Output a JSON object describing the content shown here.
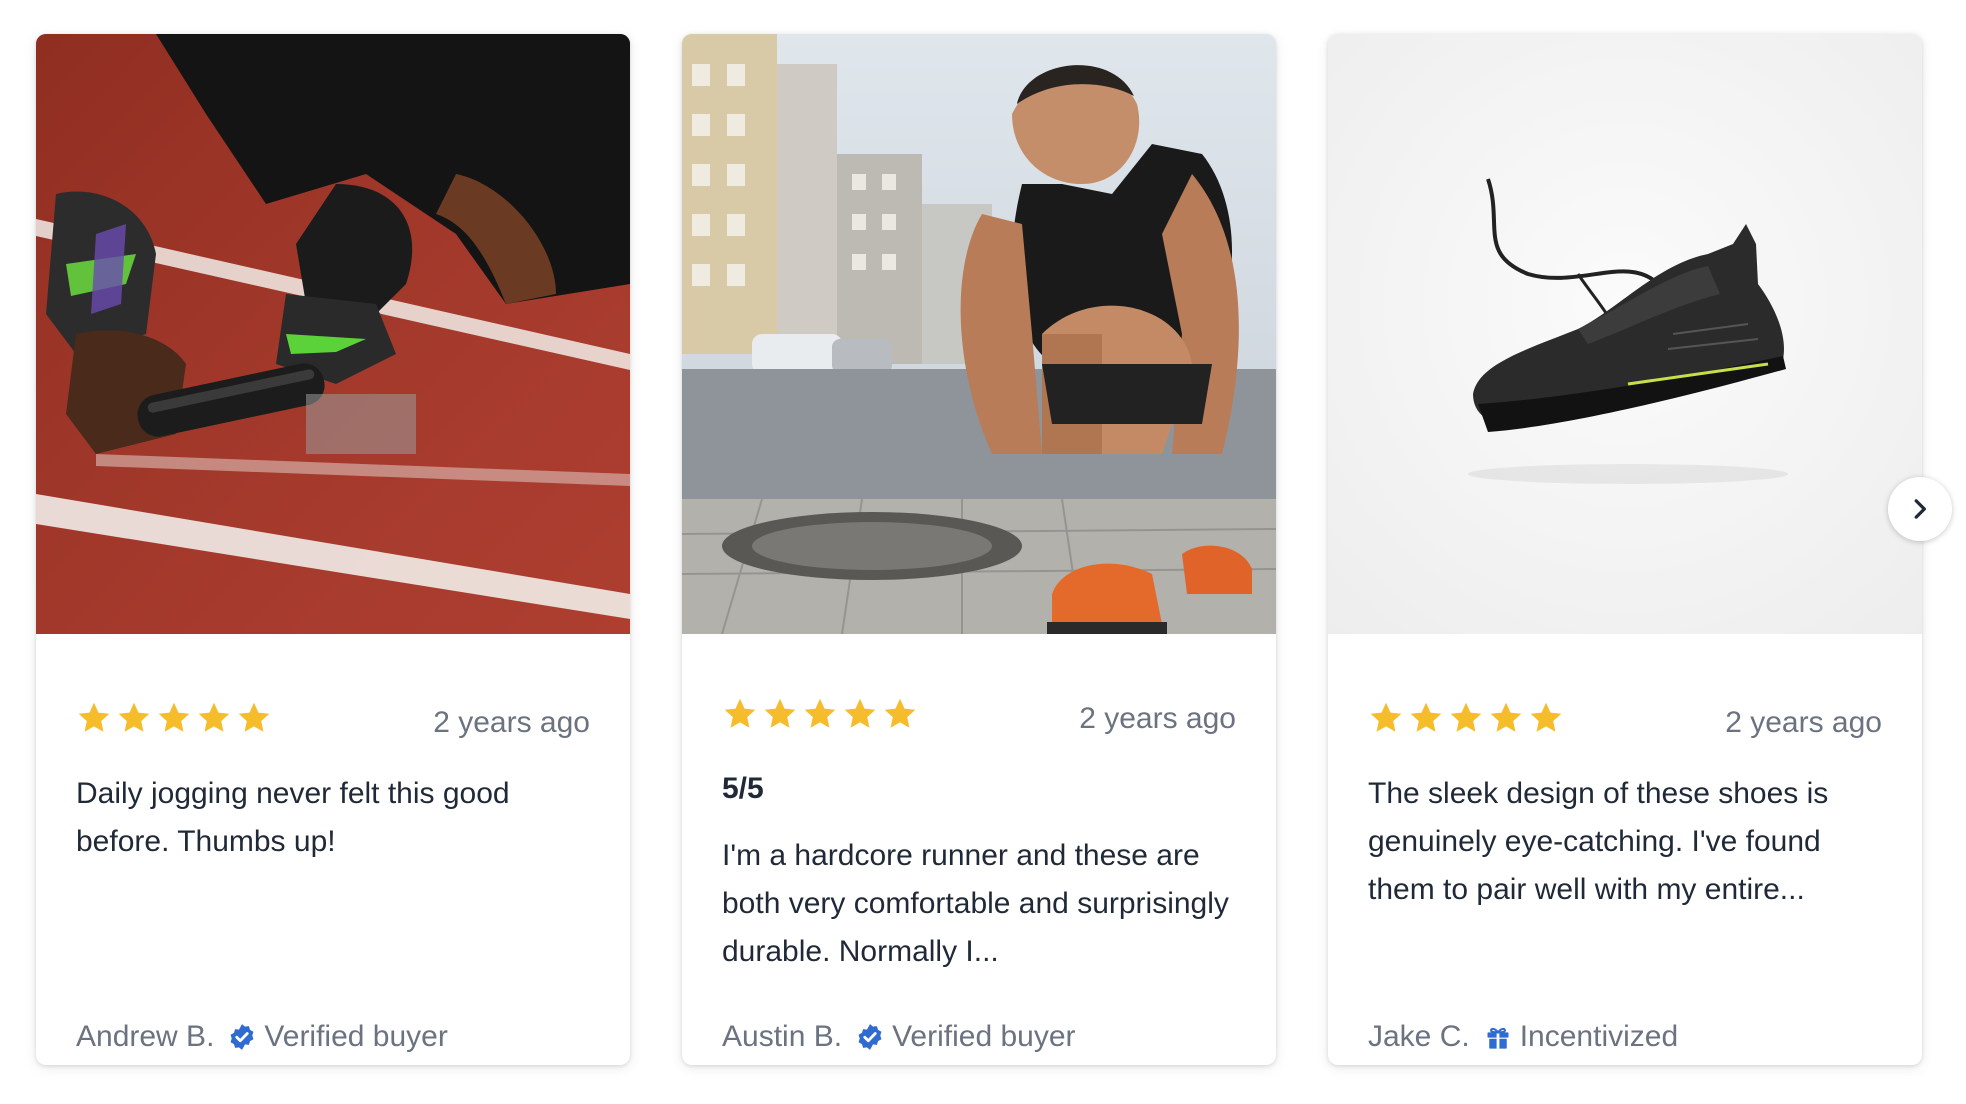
{
  "reviews": [
    {
      "image": "runner-starting-blocks-on-track-photo",
      "rating": 5,
      "date": "2 years ago",
      "title": "",
      "text": "Daily jogging never felt this good before. Thumbs up!",
      "author": "Andrew B.",
      "badge_icon": "verified-check-icon",
      "badge": "Verified buyer"
    },
    {
      "image": "man-tying-shoelaces-on-street-photo",
      "rating": 5,
      "date": "2 years ago",
      "title": "5/5",
      "text": "I'm a hardcore runner and these are both very comfortable and surprisingly durable. Normally I...",
      "author": "Austin B.",
      "badge_icon": "verified-check-icon",
      "badge": "Verified buyer"
    },
    {
      "image": "black-running-shoe-product-photo",
      "rating": 5,
      "date": "2 years ago",
      "title": "",
      "text": "The sleek design of these shoes is genuinely eye-catching. I've found them to pair well with my entire...",
      "author": "Jake C.",
      "badge_icon": "gift-icon",
      "badge": "Incentivized"
    }
  ],
  "navigation": {
    "next_icon": "chevron-right-icon"
  },
  "colors": {
    "star": "#f5bd2b",
    "badge": "#2f6bd0",
    "text": "#1f2937",
    "muted": "#6b7280"
  }
}
